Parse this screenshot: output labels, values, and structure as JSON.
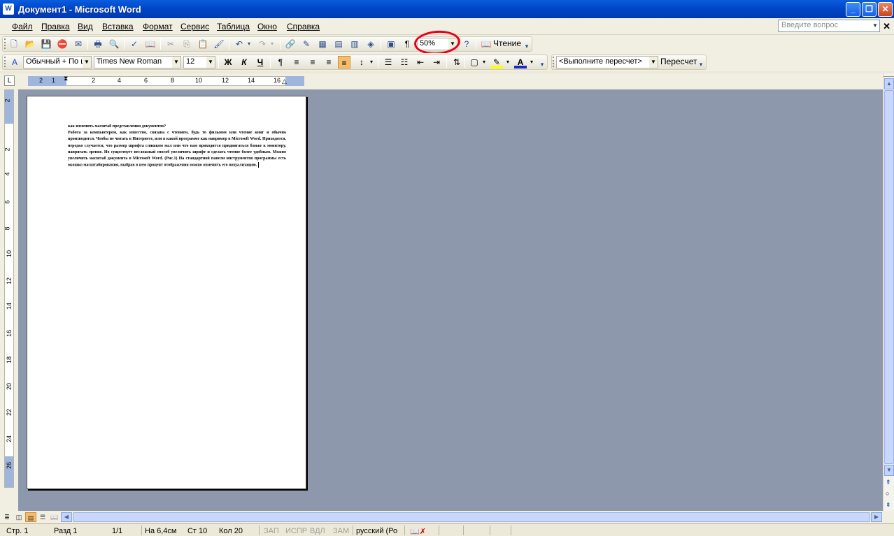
{
  "window": {
    "title": "Документ1 - Microsoft Word"
  },
  "menu": {
    "items": [
      "Файл",
      "Правка",
      "Вид",
      "Вставка",
      "Формат",
      "Сервис",
      "Таблица",
      "Окно",
      "Справка"
    ],
    "ask_placeholder": "Введите вопрос"
  },
  "toolbar1": {
    "zoom": "50%",
    "read_label": "Чтение"
  },
  "toolbar2": {
    "style": "Обычный + По ц",
    "font": "Times New Roman",
    "size": "12",
    "recalc_combo": "<Выполните пересчет>",
    "recalc_button": "Пересчет"
  },
  "ruler": {
    "numbers": [
      "2",
      "1",
      "2",
      "4",
      "6",
      "8",
      "10",
      "12",
      "14",
      "16"
    ],
    "vnumbers": [
      "2",
      "2",
      "4",
      "6",
      "8",
      "10",
      "12",
      "14",
      "16",
      "18",
      "20",
      "22",
      "24",
      "26"
    ]
  },
  "document": {
    "paragraphs": [
      "как изменить масштаб представления документов?",
      "Работа за компьютером, как известно, связана с чтением, будь то фильмом или чтение книг и обычно производится. Чтобы не читать в Интернете, или в какой программе как например в Microsoft Word. Приходится, нередко случается, что размер шрифта слишком мал или что вам приходится придвигаться ближе к монитору, напрягать зрение. Но существует несложный способ увеличить шрифт и сделать чтение более удобным. Можно увеличить масштаб документа в Microsoft Word. (Рис.1) На стандартной панели инструментов программы есть окошко масштабирования, выбрав в нем процент отображения можно изменить его визуализацию."
    ]
  },
  "status": {
    "page": "Стр. 1",
    "section": "Разд 1",
    "pages": "1/1",
    "at": "На 6,4см",
    "line": "Ст 10",
    "col": "Кол 20",
    "rec": "ЗАП",
    "trk": "ИСПР",
    "ext": "ВДЛ",
    "ovr": "ЗАМ",
    "lang": "русский (Ро"
  }
}
